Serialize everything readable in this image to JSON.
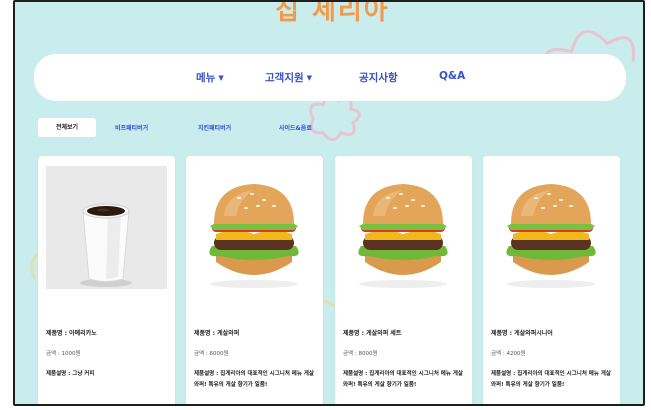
{
  "site": {
    "title": "집 세리아"
  },
  "nav": {
    "items": [
      {
        "label": "메뉴",
        "caret": "▼"
      },
      {
        "label": "고객지원",
        "caret": "▼"
      },
      {
        "label": "공지사항"
      },
      {
        "label": "Q&A"
      }
    ]
  },
  "tabs": [
    {
      "label": "전체보기",
      "active": true
    },
    {
      "label": "비프패티버거"
    },
    {
      "label": "치킨패티버거"
    },
    {
      "label": "사이드&음료"
    }
  ],
  "products": [
    {
      "image": "coffee-cup",
      "name": "제품명 : 아메리카노",
      "price": "금액 : 1000원",
      "desc": "제품설명 : 그냥 커피"
    },
    {
      "image": "burger",
      "name": "제품명 : 게살와퍼",
      "price": "금액 : 6000원",
      "desc": "제품설명 : 집게리아의 대표적인 시그니처 메뉴 게살와퍼! 특유의 게살 향기가 일품!"
    },
    {
      "image": "burger",
      "name": "제품명 : 게살와퍼 세트",
      "price": "금액 : 8000원",
      "desc": "제품설명 : 집게리아의 대표적인 시그니처 메뉴 게살와퍼! 특유의 게살 향기가 일품!"
    },
    {
      "image": "burger",
      "name": "제품명 : 게살와퍼시니어",
      "price": "금액 : 4200원",
      "desc": "제품설명 : 집게리아의 대표적인 시그니처 메뉴 게살와퍼! 특유의 게살 향기가 일품!"
    }
  ],
  "colors": {
    "background": "#c9ecec",
    "accent": "#3552c9",
    "title": "#f2994a"
  }
}
